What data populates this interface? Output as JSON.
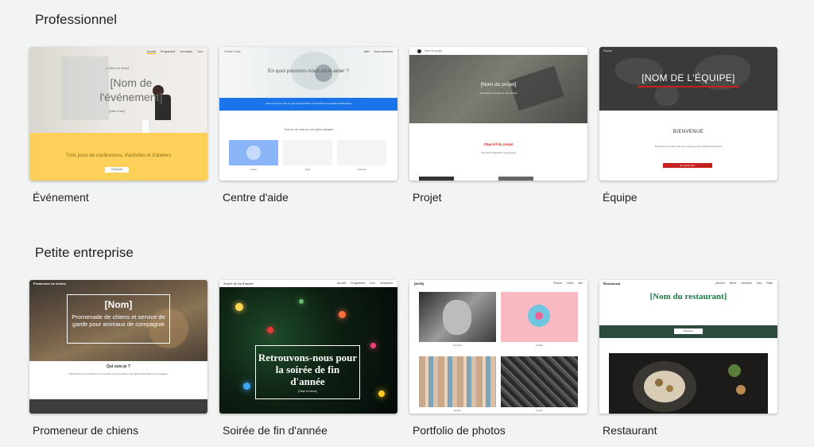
{
  "sections": [
    {
      "title": "Professionnel",
      "cards": [
        {
          "label": "Événement",
          "preview": {
            "nav": [
              "Accueil",
              "Programme",
              "Inscription",
              "Lieu"
            ],
            "small_title": "Le [Nom de l'évén]",
            "title": "[Nom de l'événement]",
            "date": "[Date et lieu]",
            "tagline": "Trois jours de conférences, d'activités et d'ateliers",
            "button": "S'inscrire"
          }
        },
        {
          "label": "Centre d'aide",
          "preview": {
            "brand": "Centre d'aide",
            "nav": [
              "Aide",
              "Nous contacter"
            ],
            "heading": "En quoi pouvons-nous vous aider ?",
            "banner": "Vous ne trouvez pas ce que vous cherchez ? Consultez nos questions fréquentes",
            "subheading": "Trouvez de l'aide sur les sujets suivants",
            "topics": [
              "Guide",
              "FAQ",
              "Tutoriels"
            ]
          }
        },
        {
          "label": "Projet",
          "preview": {
            "brand": "Nom du projet",
            "title": "[Nom du projet]",
            "subtitle": "Description du projet en une phrase",
            "objective_title": "Objectif du projet",
            "objective_text": "Décrivez l'objectif de votre projet"
          }
        },
        {
          "label": "Équipe",
          "preview": {
            "brand": "Équipe",
            "title": "[NOM DE L'ÉQUIPE]",
            "welcome": "BIENVENUE",
            "text": "Présentez la mission de votre équipe et ses objectifs principaux",
            "button": "En savoir plus"
          }
        }
      ]
    },
    {
      "title": "Petite entreprise",
      "cards": [
        {
          "label": "Promeneur de chiens",
          "preview": {
            "brand": "Promeneur de chiens",
            "title": "[Nom]",
            "subtitle": "Promenade de chiens et service de garde pour animaux de compagnie",
            "about_title": "Qui suis-je ?",
            "about_text": "Présentez-vous et décrivez vos services de promenade et de garde d'animaux de compagnie."
          }
        },
        {
          "label": "Soirée de fin d'année",
          "preview": {
            "brand": "Soirée de fin d'année",
            "nav": [
              "Accueil",
              "Programme",
              "Lieu",
              "Inscription"
            ],
            "title": "Retrouvons-nous pour la soirée de fin d'année",
            "date": "[Date et heure]"
          }
        },
        {
          "label": "Portfolio de photos",
          "preview": {
            "brand": "[NOM]",
            "nav": [
              "Photos",
              "Vidéo",
              "Bio"
            ],
            "captions": [
              "Portraits",
              "Studio",
              "Sports",
              "Aérien"
            ]
          }
        },
        {
          "label": "Restaurant",
          "preview": {
            "brand": "Restaurant",
            "nav": [
              "Accueil",
              "Menu",
              "Horaires",
              "Lieu",
              "Plats"
            ],
            "title": "[Nom du restaurant]",
            "button": "Réserver"
          }
        }
      ]
    }
  ],
  "colors": {
    "page_bg": "#f2f3f3",
    "event_yellow": "#fdd05a",
    "help_blue": "#1a73e8",
    "team_red": "#c5221f",
    "restaurant_green": "#2e4c3c",
    "restaurant_title": "#1e7a46"
  }
}
